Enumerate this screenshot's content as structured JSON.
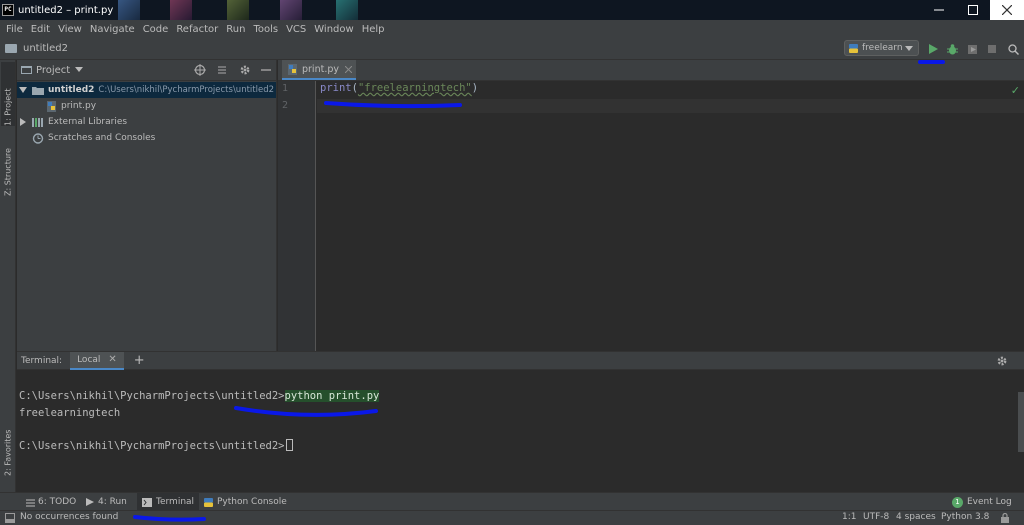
{
  "window": {
    "title": "untitled2 – print.py",
    "logo_text": "PC"
  },
  "menu": [
    "File",
    "Edit",
    "View",
    "Navigate",
    "Code",
    "Refactor",
    "Run",
    "Tools",
    "VCS",
    "Window",
    "Help"
  ],
  "navbar": {
    "project_name": "untitled2",
    "run_config": "freelearn",
    "icons": [
      "run-icon",
      "debug-icon",
      "coverage-icon",
      "stop-icon",
      "search-icon"
    ]
  },
  "left_tabs": {
    "project": "1: Project",
    "structure": "Z: Structure",
    "favorites": "2: Favorites"
  },
  "project_panel": {
    "title": "Project",
    "tree": {
      "root_name": "untitled2",
      "root_path": "C:\\Users\\nikhil\\PycharmProjects\\untitled2",
      "file": "print.py",
      "external": "External Libraries",
      "scratches": "Scratches and Consoles"
    }
  },
  "editor": {
    "tab_label": "print.py",
    "line_numbers": [
      "1",
      "2"
    ],
    "code": {
      "func": "print",
      "open": "(",
      "string": "\"freelearningtech\"",
      "close": ")"
    },
    "status_check": "✓"
  },
  "terminal": {
    "label": "Terminal:",
    "tab": "Local",
    "prompt1": "C:\\Users\\nikhil\\PycharmProjects\\untitled2>",
    "command": "python print.py",
    "output": "freelearningtech",
    "prompt2": "C:\\Users\\nikhil\\PycharmProjects\\untitled2>"
  },
  "bottom_tabs": {
    "todo": "6: TODO",
    "run": "4: Run",
    "terminal": "Terminal",
    "python_console": "Python Console",
    "event_log": "Event Log",
    "event_count": "1"
  },
  "status": {
    "message": "No occurrences found",
    "position": "1:1",
    "encoding": "UTF-8",
    "indent": "4 spaces",
    "interpreter": "Python 3.8"
  },
  "colors": {
    "accent": "#4a88c7",
    "run_green": "#59a869",
    "annotation_blue": "#0a18e8",
    "string_green": "#6a8759"
  }
}
